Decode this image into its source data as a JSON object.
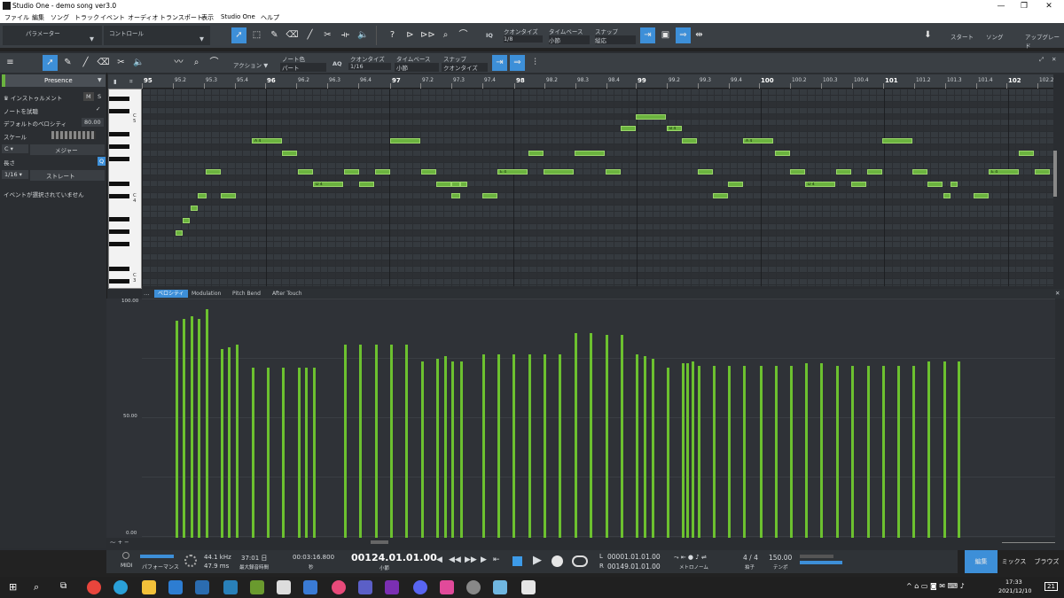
{
  "window": {
    "title": "Studio One - demo song ver3.0",
    "minimize": "—",
    "maximize": "❐",
    "close": "✕"
  },
  "menu": [
    "ファイル",
    "編集",
    "ソング",
    "トラック",
    "イベント",
    "オーディオ",
    "トランスポート",
    "表示",
    "Studio One",
    "ヘルプ"
  ],
  "toolbar": {
    "param_label": "パラメーター",
    "control_label": "コントロール",
    "quantize_label": "クオンタイズ",
    "quantize_value": "1/8",
    "timebase_label": "タイムベース",
    "timebase_value": "小節",
    "snap_label": "スナップ",
    "snap_value": "縦応",
    "iq": "IQ",
    "start": "スタート",
    "song": "ソング",
    "upgrade": "アップグレード"
  },
  "editor_toolbar": {
    "action": "アクション",
    "note_color_label": "ノート色",
    "note_color_value": "パート",
    "aq": "AQ",
    "quantize_label": "クオンタイズ",
    "quantize_value": "1/16",
    "timebase_label": "タイムベース",
    "timebase_value": "小節",
    "snap_label": "スナップ",
    "snap_value": "クオンタイズ"
  },
  "inspector": {
    "preset": "Presence",
    "instrument": "インストゥルメント",
    "m": "M",
    "s": "S",
    "audition": "ノートを試聴",
    "default_velocity_label": "デフォルトのベロシティ",
    "default_velocity": "80.00",
    "scale_label": "スケール",
    "root": "C",
    "scale": "メジャー",
    "length_label": "長さ",
    "length": "1/16",
    "length_mode": "ストレート",
    "q": "Q",
    "no_event": "イベントが選択されていません"
  },
  "keyboard": {
    "c5": "C 5",
    "c4": "C 4",
    "c3": "C 3"
  },
  "ruler": {
    "bars": [
      {
        "label": "95",
        "x": 0,
        "bar": true
      },
      {
        "label": "95.2",
        "x": 35,
        "bar": false
      },
      {
        "label": "95.3",
        "x": 70,
        "bar": false
      },
      {
        "label": "95.4",
        "x": 105,
        "bar": false
      },
      {
        "label": "96",
        "x": 139,
        "bar": true
      },
      {
        "label": "96.2",
        "x": 174,
        "bar": false
      },
      {
        "label": "96.3",
        "x": 209,
        "bar": false
      },
      {
        "label": "96.4",
        "x": 244,
        "bar": false
      },
      {
        "label": "97",
        "x": 280,
        "bar": true
      },
      {
        "label": "97.2",
        "x": 314,
        "bar": false
      },
      {
        "label": "97.3",
        "x": 349,
        "bar": false
      },
      {
        "label": "97.4",
        "x": 384,
        "bar": false
      },
      {
        "label": "98",
        "x": 420,
        "bar": true
      },
      {
        "label": "98.2",
        "x": 454,
        "bar": false
      },
      {
        "label": "98.3",
        "x": 489,
        "bar": false
      },
      {
        "label": "98.4",
        "x": 524,
        "bar": false
      },
      {
        "label": "99",
        "x": 557,
        "bar": true
      },
      {
        "label": "99.2",
        "x": 592,
        "bar": false
      },
      {
        "label": "99.3",
        "x": 627,
        "bar": false
      },
      {
        "label": "99.4",
        "x": 662,
        "bar": false
      },
      {
        "label": "100",
        "x": 696,
        "bar": true
      },
      {
        "label": "100.2",
        "x": 731,
        "bar": false
      },
      {
        "label": "100.3",
        "x": 766,
        "bar": false
      },
      {
        "label": "100.4",
        "x": 801,
        "bar": false
      },
      {
        "label": "101",
        "x": 836,
        "bar": true
      },
      {
        "label": "101.2",
        "x": 871,
        "bar": false
      },
      {
        "label": "101.3",
        "x": 906,
        "bar": false
      },
      {
        "label": "101.4",
        "x": 941,
        "bar": false
      },
      {
        "label": "102",
        "x": 975,
        "bar": true
      },
      {
        "label": "102.2",
        "x": 1010,
        "bar": false
      }
    ]
  },
  "lower_tabs": [
    "ベロシティ",
    "Modulation",
    "Pitch Bend",
    "After Touch"
  ],
  "velocity_axis": {
    "top": "100.00",
    "mid": "50.00",
    "bottom": "0.00"
  },
  "chart_data": {
    "type": "bar",
    "title": "",
    "ylabel": "",
    "ylim": [
      0,
      100
    ],
    "values": [
      92,
      93,
      94,
      93,
      97,
      80,
      81,
      82,
      72,
      72,
      72,
      72,
      72,
      72,
      82,
      82,
      82,
      82,
      82,
      75,
      76,
      77,
      75,
      75,
      78,
      78,
      78,
      78,
      78,
      78,
      87,
      87,
      86,
      86,
      78,
      77,
      76,
      72,
      74,
      74,
      75,
      73,
      73,
      73,
      73,
      73,
      73,
      73,
      74,
      74,
      73,
      73,
      73,
      73,
      73,
      73,
      75,
      75,
      75
    ]
  },
  "transport": {
    "midi": "MIDI",
    "perf": "パフォーマンス",
    "rate": "44.1 kHz",
    "latency": "47.9 ms",
    "rec_time": "37:01 日",
    "rec_label": "最大録音時間",
    "time": "00:03:16.800",
    "time_unit": "秒",
    "bars": "00124.01.01.00",
    "bars_unit": "小節",
    "loop_l": "00001.01.01.00",
    "loop_r": "00149.01.01.00",
    "l": "L",
    "r": "R",
    "sig": "4 / 4",
    "sig_label": "拍子",
    "tempo": "150.00",
    "tempo_label": "テンポ",
    "metronome": "メトロノーム"
  },
  "pages": {
    "edit": "編集",
    "mix": "ミックス",
    "browse": "ブラウズ"
  },
  "taskbar": {
    "time": "17:33",
    "date": "2021/12/10",
    "notif": "21"
  },
  "colors": {
    "accent": "#3d8fd8",
    "note": "#6bb33f",
    "velocity": "#6cc12f"
  }
}
